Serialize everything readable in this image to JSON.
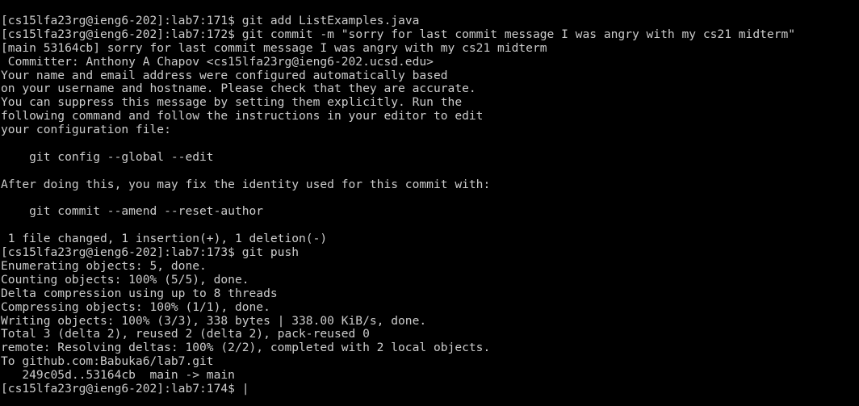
{
  "terminal": {
    "lines": [
      {
        "type": "prompt",
        "prompt": "[cs15lfa23rg@ieng6-202]:lab7:171$ ",
        "command": "git add ListExamples.java"
      },
      {
        "type": "prompt",
        "prompt": "[cs15lfa23rg@ieng6-202]:lab7:172$ ",
        "command": "git commit -m \"sorry for last commit message I was angry with my cs21 midterm\""
      },
      {
        "type": "output",
        "text": "[main 53164cb] sorry for last commit message I was angry with my cs21 midterm"
      },
      {
        "type": "output",
        "text": " Committer: Anthony A Chapov <cs15lfa23rg@ieng6-202.ucsd.edu>"
      },
      {
        "type": "output",
        "text": "Your name and email address were configured automatically based"
      },
      {
        "type": "output",
        "text": "on your username and hostname. Please check that they are accurate."
      },
      {
        "type": "output",
        "text": "You can suppress this message by setting them explicitly. Run the"
      },
      {
        "type": "output",
        "text": "following command and follow the instructions in your editor to edit"
      },
      {
        "type": "output",
        "text": "your configuration file:"
      },
      {
        "type": "output",
        "text": ""
      },
      {
        "type": "output",
        "text": "    git config --global --edit"
      },
      {
        "type": "output",
        "text": ""
      },
      {
        "type": "output",
        "text": "After doing this, you may fix the identity used for this commit with:"
      },
      {
        "type": "output",
        "text": ""
      },
      {
        "type": "output",
        "text": "    git commit --amend --reset-author"
      },
      {
        "type": "output",
        "text": ""
      },
      {
        "type": "output",
        "text": " 1 file changed, 1 insertion(+), 1 deletion(-)"
      },
      {
        "type": "prompt",
        "prompt": "[cs15lfa23rg@ieng6-202]:lab7:173$ ",
        "command": "git push"
      },
      {
        "type": "output",
        "text": "Enumerating objects: 5, done."
      },
      {
        "type": "output",
        "text": "Counting objects: 100% (5/5), done."
      },
      {
        "type": "output",
        "text": "Delta compression using up to 8 threads"
      },
      {
        "type": "output",
        "text": "Compressing objects: 100% (1/1), done."
      },
      {
        "type": "output",
        "text": "Writing objects: 100% (3/3), 338 bytes | 338.00 KiB/s, done."
      },
      {
        "type": "output",
        "text": "Total 3 (delta 2), reused 2 (delta 2), pack-reused 0"
      },
      {
        "type": "output",
        "text": "remote: Resolving deltas: 100% (2/2), completed with 2 local objects."
      },
      {
        "type": "output",
        "text": "To github.com:Babuka6/lab7.git"
      },
      {
        "type": "output",
        "text": "   249c05d..53164cb  main -> main"
      }
    ],
    "current_prompt": "[cs15lfa23rg@ieng6-202]:lab7:174$ ",
    "cursor_glyph": "|"
  }
}
